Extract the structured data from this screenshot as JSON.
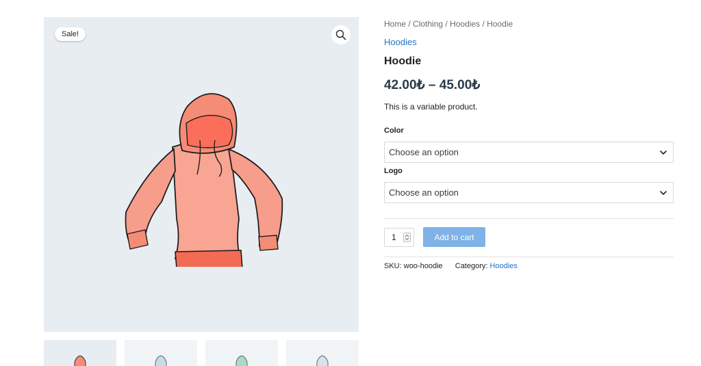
{
  "gallery": {
    "badge": "Sale!",
    "zoom_icon": "magnifier-icon",
    "image": "hoodie-drawing",
    "thumbnails": [
      "hoodie-red",
      "hoodie-blue",
      "hoodie-green",
      "hoodie-light-blue"
    ]
  },
  "breadcrumb": [
    "Home",
    "Clothing",
    "Hoodies",
    "Hoodie"
  ],
  "breadcrumb_sep": " / ",
  "category_link": "Hoodies",
  "title": "Hoodie",
  "price": "42.00₺ – 45.00₺",
  "description": "This is a variable product.",
  "variations": [
    {
      "label": "Color",
      "placeholder": "Choose an option"
    },
    {
      "label": "Logo",
      "placeholder": "Choose an option"
    }
  ],
  "cart": {
    "quantity": "1",
    "add_label": "Add to cart"
  },
  "meta": {
    "sku_label": "SKU:",
    "sku": "woo-hoodie",
    "category_label": "Category:",
    "category": "Hoodies"
  },
  "colors": {
    "link": "#1f73c9",
    "button": "#7fb2e6",
    "image_bg": "#e8edf2",
    "hoodie": "#f59a8a"
  }
}
